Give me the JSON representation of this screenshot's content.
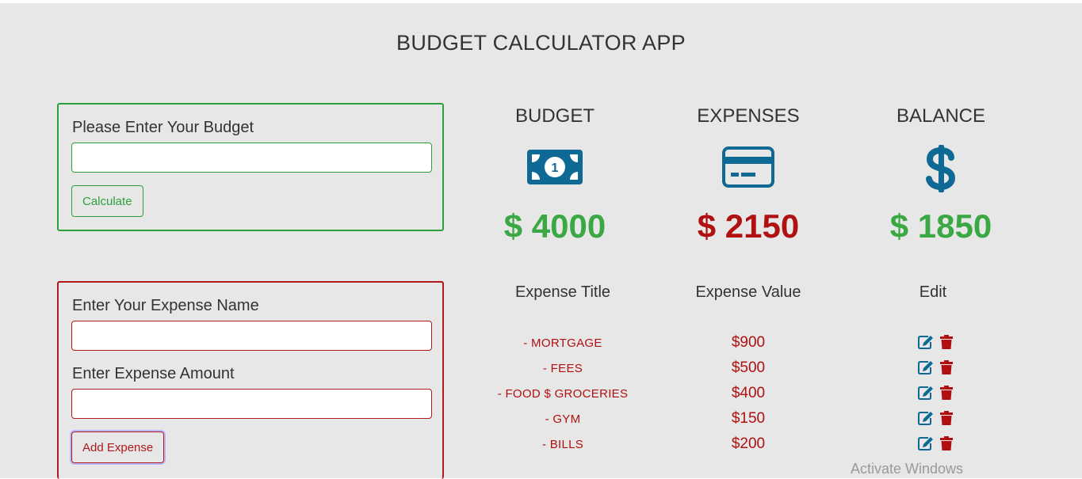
{
  "app_title": "BUDGET CALCULATOR APP",
  "budget_form": {
    "label": "Please Enter Your Budget",
    "value": "",
    "button": "Calculate"
  },
  "expense_form": {
    "name_label": "Enter Your Expense Name",
    "name_value": "",
    "amount_label": "Enter Expense Amount",
    "amount_value": "",
    "button": "Add Expense"
  },
  "summary": {
    "budget": {
      "label": "BUDGET",
      "value": "$ 4000",
      "icon": "money-bill-icon",
      "color": "#3aa843"
    },
    "expenses": {
      "label": "EXPENSES",
      "value": "$ 2150",
      "icon": "credit-card-icon",
      "color": "#b01010"
    },
    "balance": {
      "label": "BALANCE",
      "value": "$ 1850",
      "icon": "dollar-sign-icon",
      "color": "#3aa843"
    }
  },
  "table": {
    "headers": {
      "title": "Expense Title",
      "value": "Expense Value",
      "edit": "Edit"
    },
    "rows": [
      {
        "title": "- MORTGAGE",
        "value": "$900"
      },
      {
        "title": "- FEES",
        "value": "$500"
      },
      {
        "title": "- FOOD $ GROCERIES",
        "value": "$400"
      },
      {
        "title": "- GYM",
        "value": "$150"
      },
      {
        "title": "- BILLS",
        "value": "$200"
      }
    ]
  },
  "watermark": "Activate Windows",
  "colors": {
    "icon_blue": "#0e6a94",
    "green": "#3aa843",
    "red": "#b01010",
    "background": "#e7e7e7"
  }
}
